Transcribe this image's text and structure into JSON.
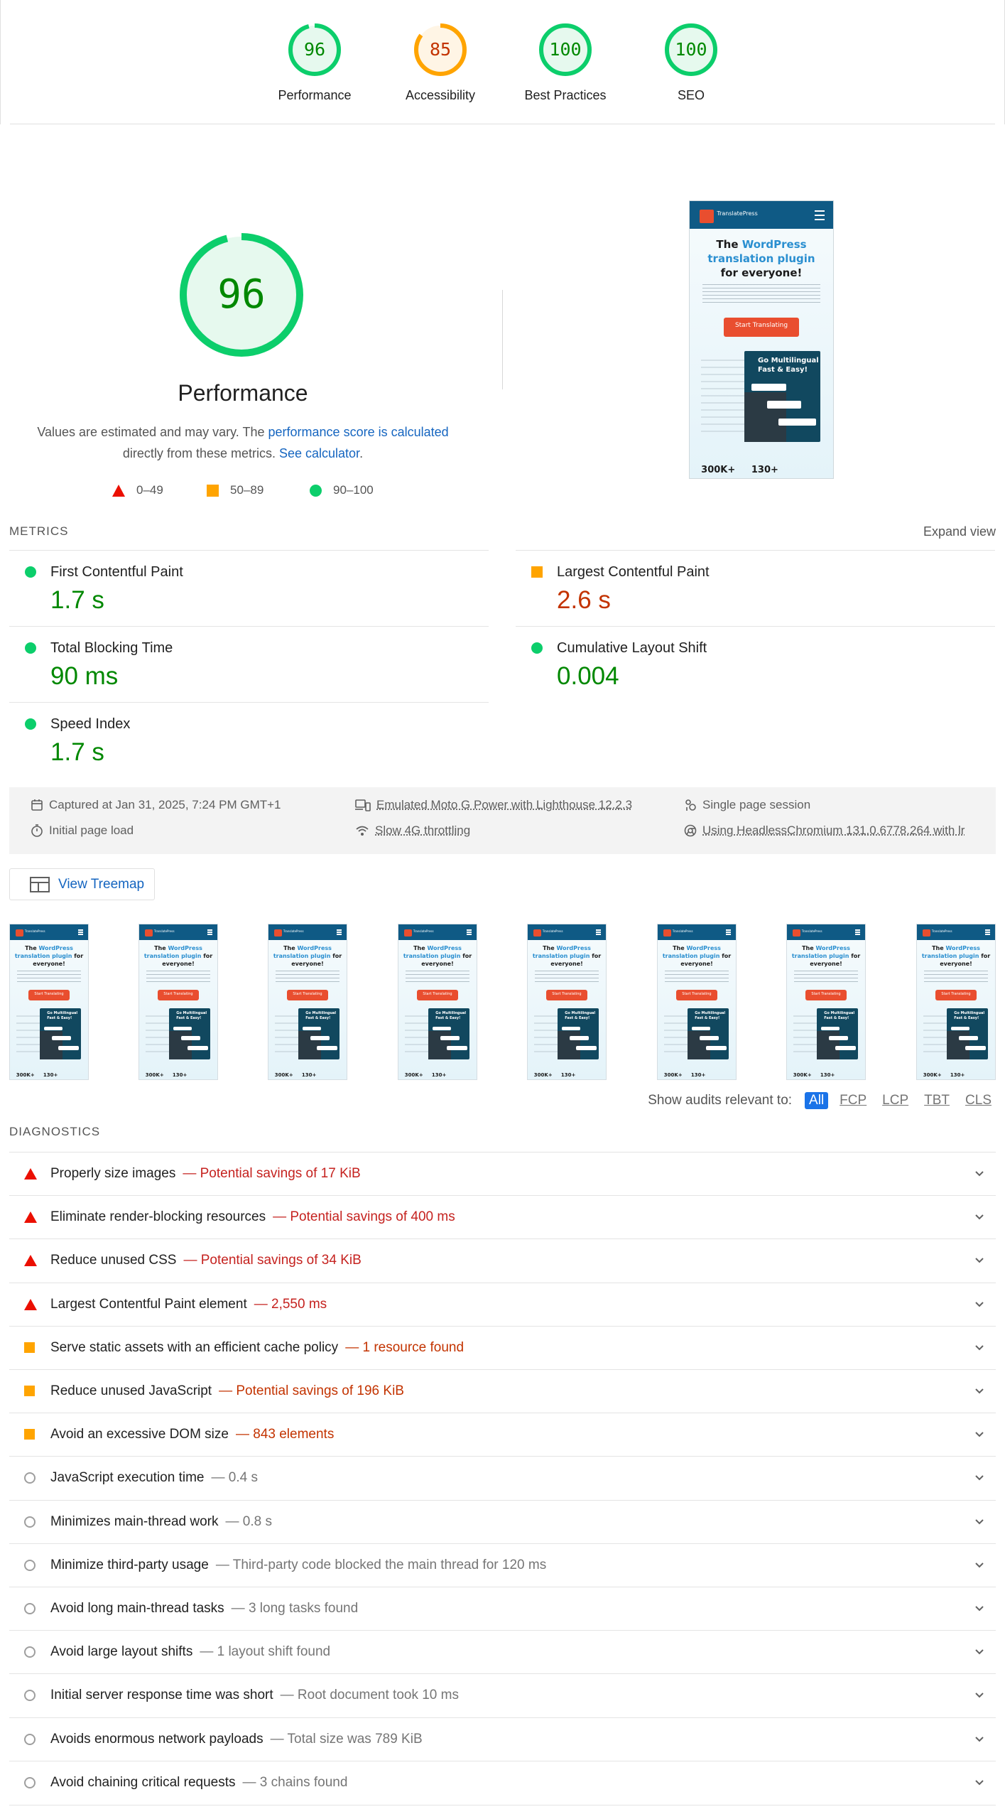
{
  "categories": [
    {
      "label": "Performance",
      "score": "96",
      "rating": "pass"
    },
    {
      "label": "Accessibility",
      "score": "85",
      "rating": "average"
    },
    {
      "label": "Best Practices",
      "score": "100",
      "rating": "pass"
    },
    {
      "label": "SEO",
      "score": "100",
      "rating": "pass"
    }
  ],
  "performance": {
    "score": "96",
    "title": "Performance",
    "desc_prefix": "Values are estimated and may vary. The ",
    "desc_link1": "performance score is calculated",
    "desc_mid": " directly from these metrics. ",
    "desc_link2": "See calculator",
    "desc_suffix": "."
  },
  "legend": {
    "fail": "0–49",
    "average": "50–89",
    "pass": "90–100"
  },
  "colors": {
    "pass": "#0cce6b",
    "average": "#ffa400",
    "fail": "#eb0f00",
    "link": "#1565c0"
  },
  "screenshot": {
    "brand": "TranslatePress",
    "headline_pre": "The ",
    "headline_hl": "WordPress translation plugin",
    "headline_post": " for everyone!",
    "cta": "Start Translating",
    "card_title": "Go Multilingual Fast & Easy!",
    "stats": "300K+     130+"
  },
  "metrics": {
    "header": "METRICS",
    "expand": "Expand view",
    "items": [
      {
        "name": "First Contentful Paint",
        "value": "1.7 s",
        "rating": "pass"
      },
      {
        "name": "Largest Contentful Paint",
        "value": "2.6 s",
        "rating": "average"
      },
      {
        "name": "Total Blocking Time",
        "value": "90 ms",
        "rating": "pass"
      },
      {
        "name": "Cumulative Layout Shift",
        "value": "0.004",
        "rating": "pass"
      },
      {
        "name": "Speed Index",
        "value": "1.7 s",
        "rating": "pass"
      }
    ]
  },
  "env": {
    "captured": "Captured at Jan 31, 2025, 7:24 PM GMT+1",
    "device": "Emulated Moto G Power with Lighthouse 12.2.3",
    "session": "Single page session",
    "load": "Initial page load",
    "throttle": "Slow 4G throttling",
    "browser": "Using HeadlessChromium 131.0.6778.264 with lr"
  },
  "treemap": {
    "label": "View Treemap"
  },
  "filters": {
    "label": "Show audits relevant to:",
    "chips": [
      "All",
      "FCP",
      "LCP",
      "TBT",
      "CLS"
    ],
    "active": "All"
  },
  "diagnostics": {
    "header": "DIAGNOSTICS",
    "items": [
      {
        "title": "Properly size images",
        "detail": "Potential savings of 17 KiB",
        "rating": "fail"
      },
      {
        "title": "Eliminate render-blocking resources",
        "detail": "Potential savings of 400 ms",
        "rating": "fail"
      },
      {
        "title": "Reduce unused CSS",
        "detail": "Potential savings of 34 KiB",
        "rating": "fail"
      },
      {
        "title": "Largest Contentful Paint element",
        "detail": "2,550 ms",
        "rating": "fail"
      },
      {
        "title": "Serve static assets with an efficient cache policy",
        "detail": "1 resource found",
        "rating": "average"
      },
      {
        "title": "Reduce unused JavaScript",
        "detail": "Potential savings of 196 KiB",
        "rating": "average"
      },
      {
        "title": "Avoid an excessive DOM size",
        "detail": "843 elements",
        "rating": "average"
      },
      {
        "title": "JavaScript execution time",
        "detail": "0.4 s",
        "rating": "info"
      },
      {
        "title": "Minimizes main-thread work",
        "detail": "0.8 s",
        "rating": "info"
      },
      {
        "title": "Minimize third-party usage",
        "detail": "Third-party code blocked the main thread for 120 ms",
        "rating": "info"
      },
      {
        "title": "Avoid long main-thread tasks",
        "detail": "3 long tasks found",
        "rating": "info"
      },
      {
        "title": "Avoid large layout shifts",
        "detail": "1 layout shift found",
        "rating": "info"
      },
      {
        "title": "Initial server response time was short",
        "detail": "Root document took 10 ms",
        "rating": "info"
      },
      {
        "title": "Avoids enormous network payloads",
        "detail": "Total size was 789 KiB",
        "rating": "info"
      },
      {
        "title": "Avoid chaining critical requests",
        "detail": "3 chains found",
        "rating": "info"
      }
    ]
  }
}
